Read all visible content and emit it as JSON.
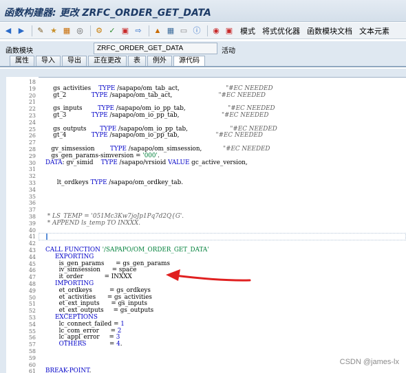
{
  "window": {
    "title": "函数构建器: 更改 ZRFC_ORDER_GET_DATA"
  },
  "toolbar": {
    "icons": [
      "back-icon",
      "forward-icon",
      "display-change-icon",
      "other-object-icon",
      "activate-icon",
      "check-icon",
      "where-used-icon",
      "test-icon",
      "pattern-icon",
      "pretty-printer-icon",
      "frame-icon",
      "settings-icon",
      "info-icon",
      "breakpoint-icon",
      "session-breakpoint-icon"
    ],
    "buttons": {
      "mode": "模式",
      "pretty_printer": "将式优化器",
      "module_doc": "函数模块文档",
      "text_elements": "文本元素"
    }
  },
  "function_module": {
    "label": "函数模块",
    "name": "ZRFC_ORDER_GET_DATA",
    "status": "活动"
  },
  "tabs": [
    {
      "label": "属性",
      "active": false
    },
    {
      "label": "导入",
      "active": false
    },
    {
      "label": "导出",
      "active": false
    },
    {
      "label": "正在更改",
      "active": false
    },
    {
      "label": "表",
      "active": false
    },
    {
      "label": "例外",
      "active": false
    },
    {
      "label": "源代码",
      "active": true
    }
  ],
  "code": {
    "lines": [
      {
        "n": "18",
        "t": ""
      },
      {
        "n": "19",
        "t": "    gs_activities    TYPE /sapapo/om_tab_act,                        \"#EC NEEDED"
      },
      {
        "n": "20",
        "t": "    gt_2             TYPE /sapapo/om_tab_act,                        \"#EC NEEDED"
      },
      {
        "n": "21",
        "t": ""
      },
      {
        "n": "22",
        "t": "    gs_inputs        TYPE /sapapo/om_io_pp_tab,                      \"#EC NEEDED"
      },
      {
        "n": "23",
        "t": "    gt_3             TYPE /sapapo/om_io_pp_tab,                      \"#EC NEEDED"
      },
      {
        "n": "24",
        "t": ""
      },
      {
        "n": "25",
        "t": "    gs_outputs       TYPE /sapapo/om_io_pp_tab,                      \"#EC NEEDED"
      },
      {
        "n": "26",
        "t": "    gt_4             TYPE /sapapo/om_io_pp_tab,                   \"#EC NEEDED"
      },
      {
        "n": "27",
        "t": ""
      },
      {
        "n": "28",
        "t": "   gv_simsession        TYPE /sapapo/om_simsession,           \"#EC NEEDED"
      },
      {
        "n": "29",
        "t": "   gs_gen_params-simversion = '000'."
      },
      {
        "n": "30",
        "t": "DATA: gv_simid    TYPE /sapapo/vrsioid VALUE gc_active_version,"
      },
      {
        "n": "31",
        "t": ""
      },
      {
        "n": "32",
        "t": ""
      },
      {
        "n": "33",
        "t": "      lt_ordkeys TYPE /sapapo/om_ordkey_tab."
      },
      {
        "n": "34",
        "t": ""
      },
      {
        "n": "35",
        "t": ""
      },
      {
        "n": "36",
        "t": ""
      },
      {
        "n": "37",
        "t": ""
      },
      {
        "n": "38",
        "t": " * LS_TEMP = '051Mc3Kw7joJp1Pq7d2Q{G'."
      },
      {
        "n": "39",
        "t": " * APPEND ls_temp TO INXXX."
      },
      {
        "n": "40",
        "t": ""
      },
      {
        "n": "41",
        "t": ""
      },
      {
        "n": "42",
        "t": ""
      },
      {
        "n": "43",
        "t": "CALL FUNCTION '/SAPAPO/OM_ORDER_GET_DATA'"
      },
      {
        "n": "44",
        "t": "     EXPORTING"
      },
      {
        "n": "45",
        "t": "       is_gen_params      = gs_gen_params"
      },
      {
        "n": "46",
        "t": "       iv_simsession      = space"
      },
      {
        "n": "47",
        "t": "       it_order           = INXXX"
      },
      {
        "n": "48",
        "t": "     IMPORTING"
      },
      {
        "n": "49",
        "t": "       et_ordkeys         = gs_ordkeys"
      },
      {
        "n": "50",
        "t": "       et_activities      = gs_activities"
      },
      {
        "n": "51",
        "t": "       et_ext_inputs      = gs_inputs"
      },
      {
        "n": "52",
        "t": "       et_ext_outputs     = gs_outputs"
      },
      {
        "n": "53",
        "t": "     EXCEPTIONS"
      },
      {
        "n": "54",
        "t": "       lc_connect_failed = 1"
      },
      {
        "n": "55",
        "t": "       lc_com_error      = 2"
      },
      {
        "n": "56",
        "t": "       lc_appl_error     = 3"
      },
      {
        "n": "57",
        "t": "       OTHERS            = 4."
      },
      {
        "n": "58",
        "t": ""
      },
      {
        "n": "59",
        "t": ""
      },
      {
        "n": "60",
        "t": ""
      },
      {
        "n": "61",
        "t": "BREAK-POINT."
      }
    ]
  },
  "annotation": {
    "arrow_color": "#e02020"
  },
  "watermark": "CSDN @james-lx",
  "colors": {
    "keyword": "#0000c8",
    "string": "#00803a",
    "comment": "#606060",
    "title": "#1c3a66"
  }
}
